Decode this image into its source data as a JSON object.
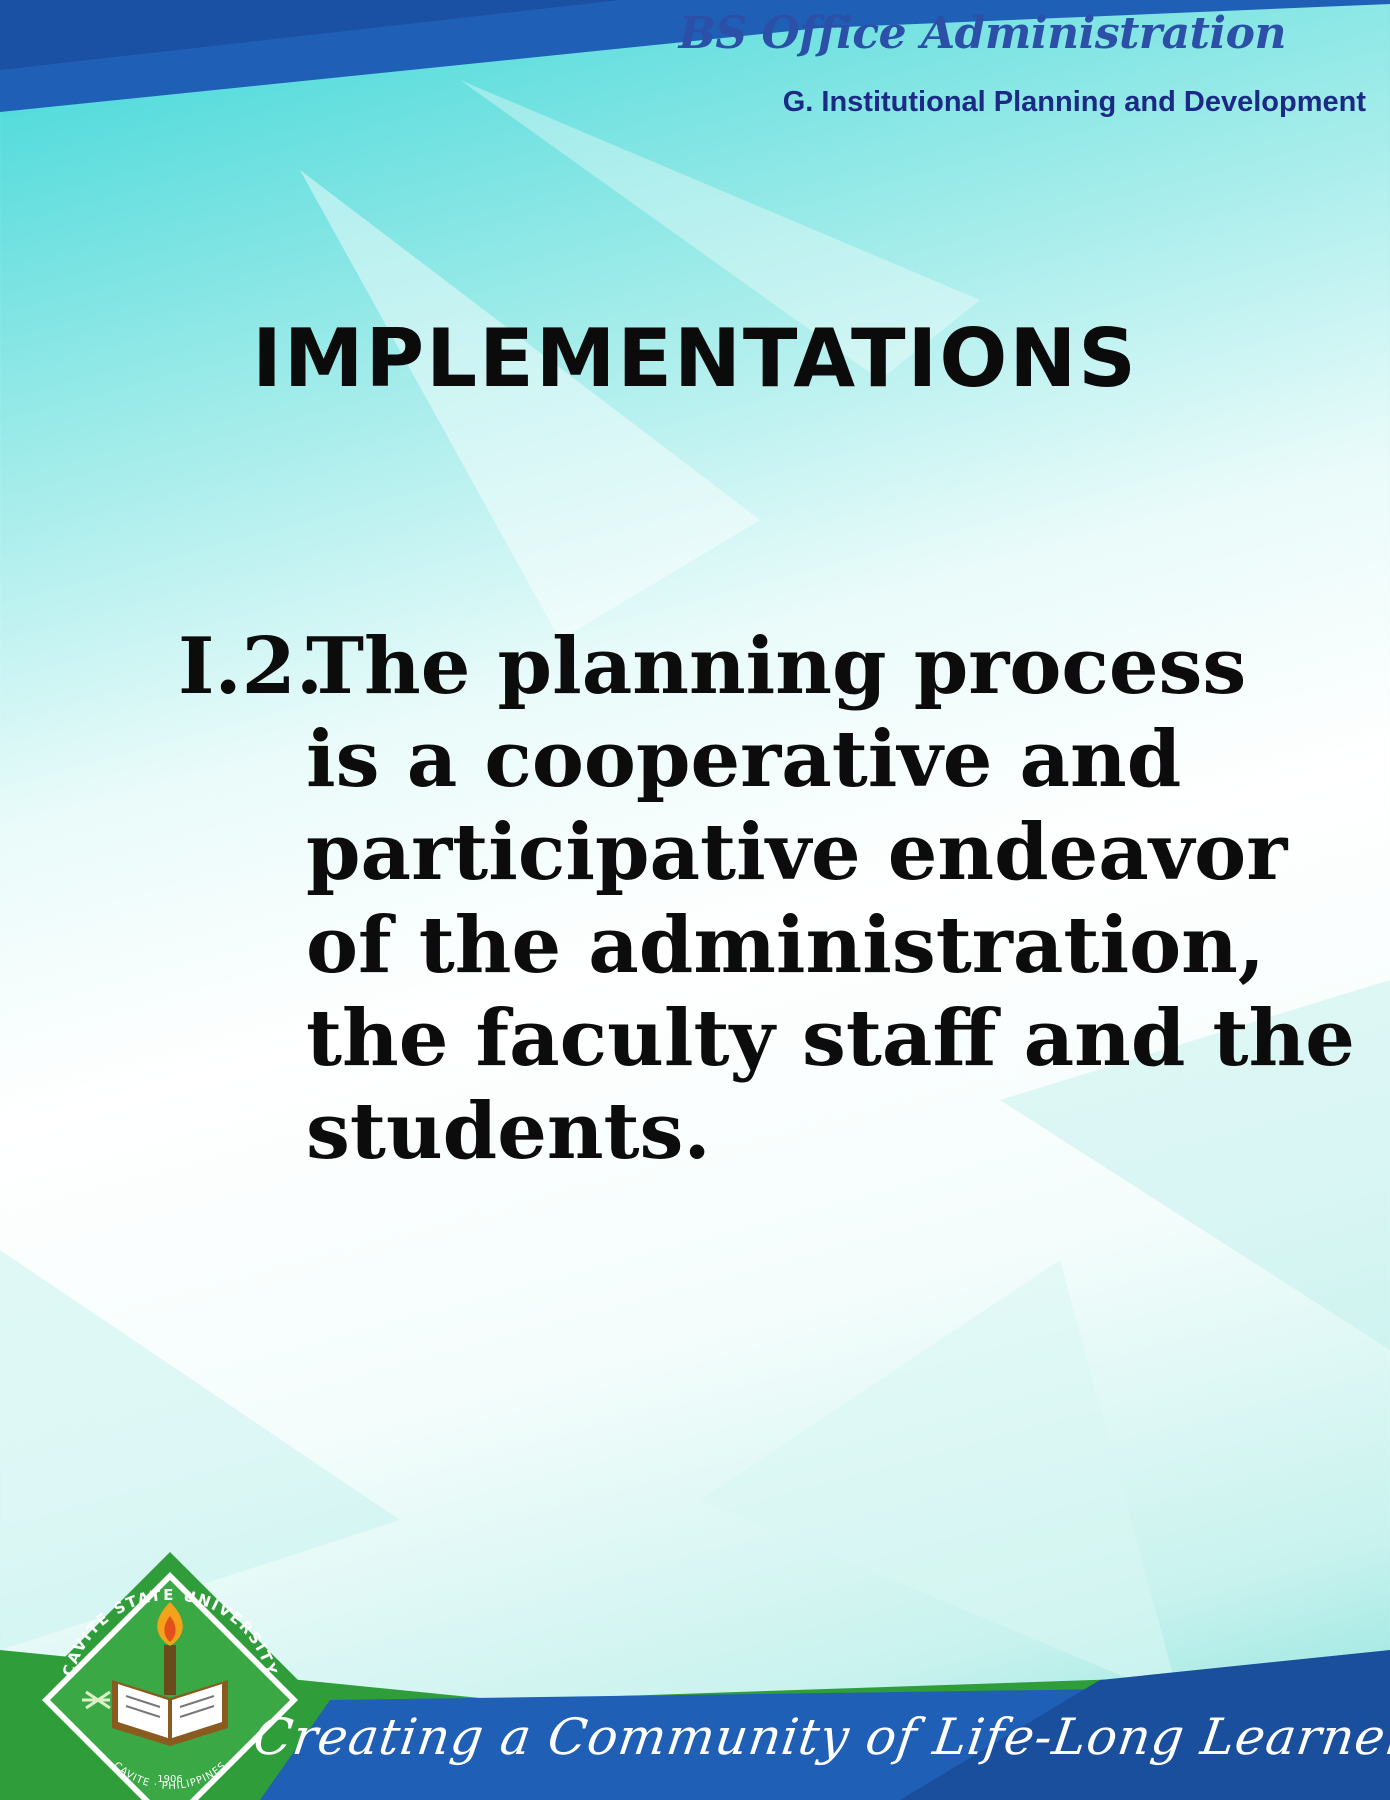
{
  "header": {
    "program": "BS Office Administration",
    "section": "G. Institutional Planning and Development"
  },
  "title": "IMPLEMENTATIONS",
  "criterion": {
    "number": "I.2.",
    "lines": [
      "The planning process",
      "is a cooperative and",
      "participative endeavor",
      "of the administration,",
      "the faculty staff and the",
      "students."
    ]
  },
  "footer": {
    "tagline": "Creating a Community of Life-Long Learners",
    "logo_text_top": "CAVITE STATE UNIVERSITY",
    "logo_text_bottom": "CAVITE · PHILIPPINES",
    "logo_year": "1906"
  },
  "colors": {
    "header_blue": "#2c4fa8",
    "section_navy": "#1c2a86",
    "footer_green": "#2f9e3a",
    "footer_blue": "#1f5fb5"
  }
}
